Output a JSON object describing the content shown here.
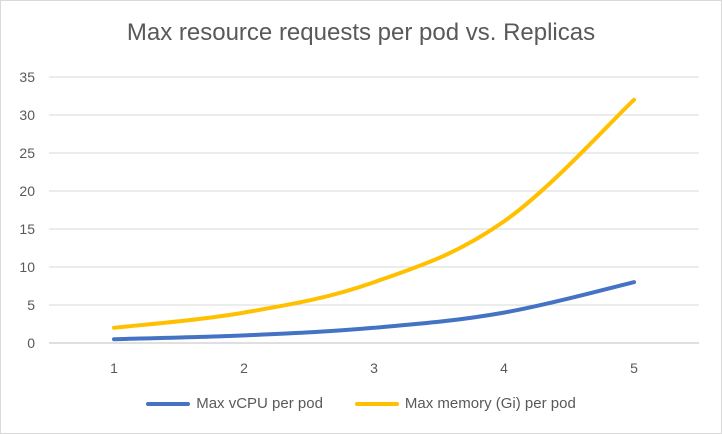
{
  "chart_data": {
    "type": "line",
    "title": "Max resource requests per pod vs. Replicas",
    "categories": [
      "1",
      "2",
      "3",
      "4",
      "5"
    ],
    "series": [
      {
        "name": "Max vCPU per pod",
        "values": [
          0.5,
          1,
          2,
          4,
          8
        ],
        "color": "#4472C4"
      },
      {
        "name": "Max memory (Gi) per pod",
        "values": [
          2,
          4,
          8,
          16,
          32
        ],
        "color": "#FFC000"
      }
    ],
    "ylim": [
      0,
      35
    ],
    "yticks": [
      0,
      5,
      10,
      15,
      20,
      25,
      30,
      35
    ],
    "grid": true,
    "legend": "bottom"
  }
}
